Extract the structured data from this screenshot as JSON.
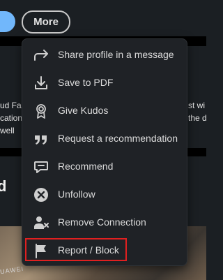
{
  "top_actions": {
    "more_label": "More"
  },
  "background_card": {
    "line1_left": "ud Fa",
    "line1_right": "st wi",
    "line2_left": "cation",
    "line2_right": "the d",
    "line3_left": " well"
  },
  "section": {
    "heading": "d"
  },
  "photo": {
    "label": "UAWEI"
  },
  "menu": {
    "items": [
      {
        "label": "Share profile in a message",
        "icon": "share-arrow-icon"
      },
      {
        "label": "Save to PDF",
        "icon": "download-icon"
      },
      {
        "label": "Give Kudos",
        "icon": "kudos-medal-icon"
      },
      {
        "label": "Request a recommendation",
        "icon": "quote-icon"
      },
      {
        "label": "Recommend",
        "icon": "speech-bubble-icon"
      },
      {
        "label": "Unfollow",
        "icon": "close-circle-icon"
      },
      {
        "label": "Remove Connection",
        "icon": "person-remove-icon"
      },
      {
        "label": "Report / Block",
        "icon": "flag-icon"
      }
    ]
  },
  "colors": {
    "background": "#1b1f23",
    "menu_background": "#1f2226",
    "text": "#dcdcdc",
    "accent_blue": "#71b7fb",
    "highlight_red": "#e02020"
  }
}
